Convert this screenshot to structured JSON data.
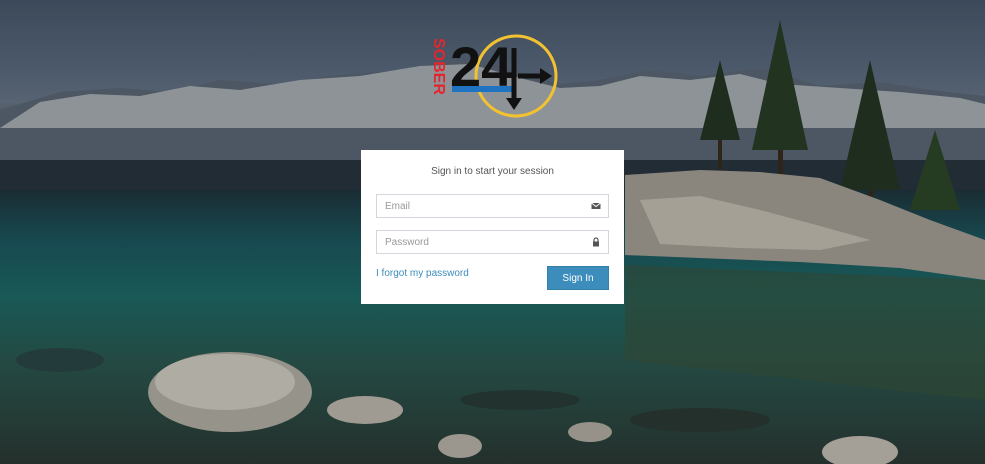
{
  "brand": {
    "logo_text_vertical": "SOBER",
    "logo_number": "24"
  },
  "login": {
    "message": "Sign in to start your session",
    "email_placeholder": "Email",
    "password_placeholder": "Password",
    "forgot_link": "I forgot my password",
    "signin_label": "Sign In"
  },
  "icons": {
    "email": "envelope-icon",
    "password": "lock-icon"
  },
  "colors": {
    "primary": "#3c8dbc",
    "link": "#3c8dbc",
    "logo_red": "#e3262e",
    "logo_blue": "#1f73c1",
    "logo_yellow": "#f2c230"
  }
}
